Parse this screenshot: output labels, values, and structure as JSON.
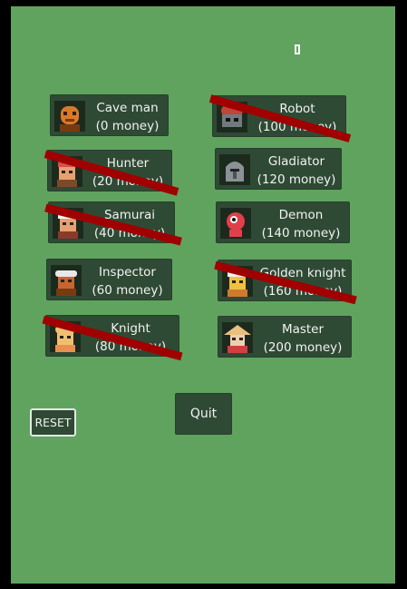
{
  "characters": [
    {
      "key": "caveman",
      "name": "Cave man",
      "price": "(0 money)",
      "locked": false,
      "icon": "caveman-portrait-icon",
      "colors": [
        "#d97a2b",
        "#7a3a10"
      ]
    },
    {
      "key": "robot",
      "name": "Robot",
      "price": "(100 money)",
      "locked": true,
      "icon": "robot-portrait-icon",
      "colors": [
        "#c0453a",
        "#6f7b7f"
      ]
    },
    {
      "key": "hunter",
      "name": "Hunter",
      "price": "(20 money)",
      "locked": true,
      "icon": "hunter-portrait-icon",
      "colors": [
        "#d85050",
        "#7b4a2a"
      ]
    },
    {
      "key": "gladiator",
      "name": "Gladiator",
      "price": "(120 money)",
      "locked": false,
      "icon": "gladiator-portrait-icon",
      "colors": [
        "#8a9296",
        "#4a5256"
      ]
    },
    {
      "key": "samurai",
      "name": "Samurai",
      "price": "(40 money)",
      "locked": true,
      "icon": "samurai-portrait-icon",
      "colors": [
        "#f1f1f1",
        "#8a3a2a"
      ]
    },
    {
      "key": "demon",
      "name": "Demon",
      "price": "(140 money)",
      "locked": false,
      "icon": "demon-portrait-icon",
      "colors": [
        "#e0404a",
        "#ffffff"
      ]
    },
    {
      "key": "inspector",
      "name": "Inspector",
      "price": "(60 money)",
      "locked": false,
      "icon": "inspector-portrait-icon",
      "colors": [
        "#e8e8e8",
        "#c7652e"
      ]
    },
    {
      "key": "golden",
      "name": "Golden knight",
      "price": "(160 money)",
      "locked": true,
      "icon": "golden-knight-portrait-icon",
      "colors": [
        "#f0c040",
        "#d07a30"
      ]
    },
    {
      "key": "knight",
      "name": "Knight",
      "price": "(80 money)",
      "locked": true,
      "icon": "knight-portrait-icon",
      "colors": [
        "#f0c070",
        "#e89050"
      ]
    },
    {
      "key": "master",
      "name": "Master",
      "price": "(200 money)",
      "locked": false,
      "icon": "master-portrait-icon",
      "colors": [
        "#e8c080",
        "#d04040"
      ]
    }
  ],
  "buttons": {
    "quit": "Quit",
    "reset": "RESET"
  },
  "colors": {
    "background": "#5fa35f",
    "button": "#2f4a34",
    "lock_slash": "#a00000"
  }
}
